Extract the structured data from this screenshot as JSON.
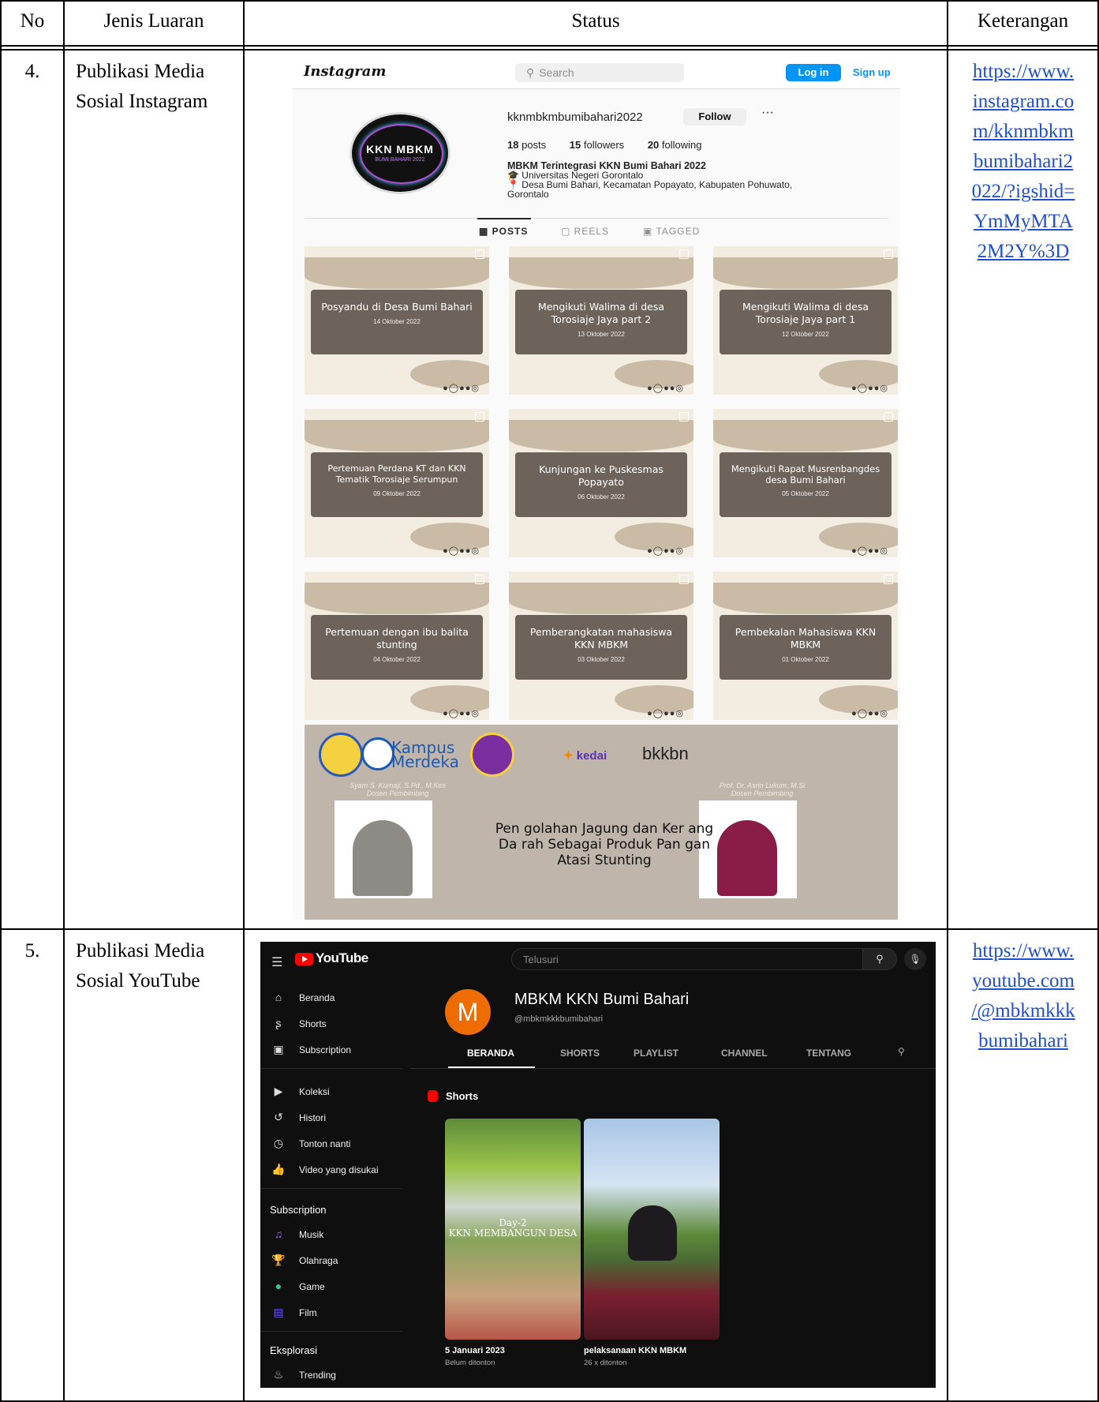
{
  "table": {
    "headers": {
      "no": "No",
      "jenis": "Jenis Luaran",
      "status": "Status",
      "keterangan": "Keterangan"
    },
    "rows": [
      {
        "no": "4.",
        "jenis_line1": "Publikasi Media",
        "jenis_line2": "Sosial Instagram",
        "link_lines": [
          "https://www.",
          "instagram.co",
          "m/kknmbkm",
          "bumibahari2",
          "022/?igshid=",
          "YmMyMTA",
          "2M2Y%3D"
        ]
      },
      {
        "no": "5.",
        "jenis_line1": "Publikasi Media",
        "jenis_line2": "Sosial YouTube",
        "link_lines": [
          "https://www.",
          "youtube.com",
          "/@mbkmkkk",
          "bumibahari"
        ]
      }
    ]
  },
  "instagram": {
    "logo": "Instagram",
    "search_placeholder": "Search",
    "login_label": "Log in",
    "signup_label": "Sign up",
    "avatar_title": "KKN MBKM",
    "avatar_subtitle": "BUMI BAHARI 2022",
    "username": "kknmbkmbumibahari2022",
    "follow_label": "Follow",
    "more_label": "···",
    "stats": {
      "posts_n": "18",
      "posts_l": "posts",
      "followers_n": "15",
      "followers_l": "followers",
      "following_n": "20",
      "following_l": "following"
    },
    "bio": {
      "name": "MBKM Terintegrasi KKN Bumi Bahari 2022",
      "line1": "🎓 Universitas Negeri Gorontalo",
      "line2": "📍 Desa Bumi Bahari, Kecamatan Popayato, Kabupaten Pohuwato,",
      "line3": "Gorontalo"
    },
    "tabs": {
      "posts": "POSTS",
      "reels": "REELS",
      "tagged": "TAGGED"
    },
    "posts": [
      {
        "title": "Posyandu di Desa Bumi Bahari",
        "date": "14 Oktober 2022"
      },
      {
        "title": "Mengikuti Walima di desa Torosiaje Jaya part 2",
        "date": "13 Oktober 2022"
      },
      {
        "title": "Mengikuti Walima di desa Torosiaje Jaya part 1",
        "date": "12 Oktober 2022"
      },
      {
        "title": "Pertemuan Perdana KT dan KKN Tematik Torosiaje Serumpun",
        "date": "09 Oktober 2022"
      },
      {
        "title": "Kunjungan ke Puskesmas Popayato",
        "date": "06 Oktober 2022"
      },
      {
        "title": "Mengikuti Rapat Musrenbangdes desa Bumi Bahari",
        "date": "05 Oktober 2022"
      },
      {
        "title": "Pertemuan dengan ibu balita stunting",
        "date": "04 Oktober 2022"
      },
      {
        "title": "Pemberangkatan mahasiswa KKN MBKM",
        "date": "03 Oktober 2022"
      },
      {
        "title": "Pembekalan Mahasiswa KKN MBKM",
        "date": "01 Oktober 2022"
      }
    ],
    "big_post": {
      "kampus": "Kampus",
      "merdeka": "Merdeka",
      "kedai": "kedai",
      "bkkbn": "bkkbn",
      "dosen1_name": "Syam S. Kumaji, S.Pd., M.Kes",
      "dosen1_role": "Dosen Pembimbing",
      "dosen2_name": "Prof. Dr. Asrin Lukum, M.Si",
      "dosen2_role": "Dosen Pembimbing",
      "title_line1": "Pen golahan Jagung dan Ker ang",
      "title_line2": "Da rah Sebagai Produk Pan gan",
      "title_line3": "Atasi Stunting"
    }
  },
  "youtube": {
    "wordmark": "YouTube",
    "search_placeholder": "Telusuri",
    "sidebar": {
      "main": [
        "Beranda",
        "Shorts",
        "Subscription"
      ],
      "library": [
        "Koleksi",
        "Histori",
        "Tonton nanti",
        "Video yang disukai"
      ],
      "subs_header": "Subscription",
      "subs": [
        "Musik",
        "Olahraga",
        "Game",
        "Film"
      ],
      "explore_header": "Eksplorasi",
      "explore": [
        "Trending"
      ]
    },
    "channel": {
      "avatar_letter": "M",
      "name": "MBKM KKN Bumi Bahari",
      "handle": "@mbkmkkkbumibahari"
    },
    "tabs": [
      "BERANDA",
      "SHORTS",
      "PLAYLIST",
      "CHANNEL",
      "TENTANG"
    ],
    "shorts_header": "Shorts",
    "shorts": [
      {
        "title": "5 Januari 2023",
        "views": "Belum ditonton",
        "overlay_line1": "Day-2",
        "overlay_line2": "KKN MEMBANGUN DESA"
      },
      {
        "title": "pelaksanaan KKN MBKM",
        "views": "26 x ditonton"
      }
    ]
  }
}
